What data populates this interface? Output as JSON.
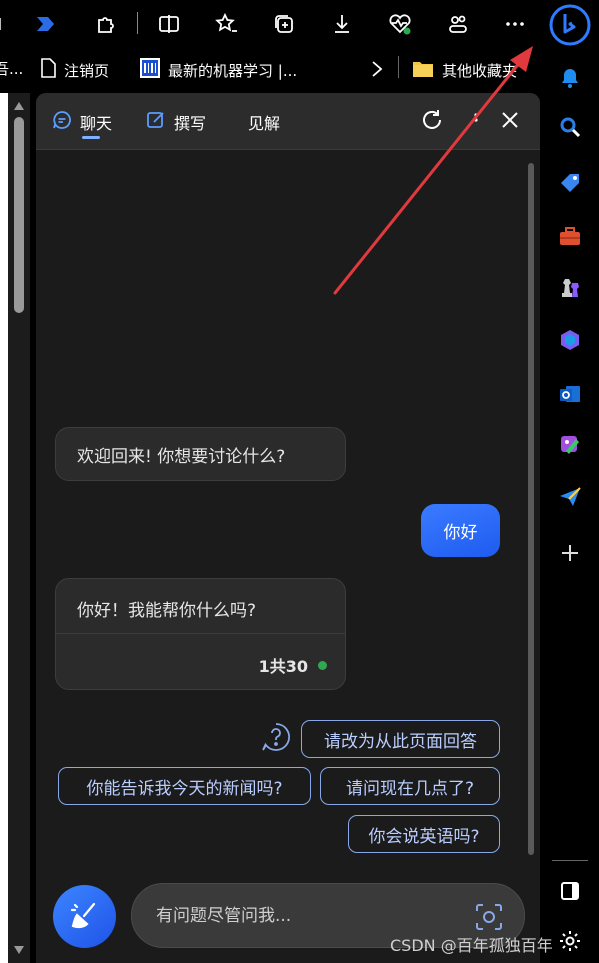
{
  "favorites": {
    "partial_left": "吾...",
    "items": [
      {
        "label": "注销页"
      },
      {
        "label": "最新的机器学习 |..."
      }
    ],
    "other_folder": "其他收藏夹"
  },
  "chat": {
    "tabs": [
      {
        "label": "聊天"
      },
      {
        "label": "撰写"
      },
      {
        "label": "见解"
      }
    ],
    "messages": {
      "welcome": "欢迎回来! 你想要讨论什么?",
      "user": "你好",
      "reply": "你好！我能帮你什么吗?",
      "counter": "1共30"
    },
    "suggestions": [
      "请改为从此页面回答",
      "你能告诉我今天的新闻吗?",
      "请问现在几点了?",
      "你会说英语吗?"
    ],
    "input_placeholder": "有问题尽管问我..."
  },
  "watermark": "CSDN @百年孤独百年",
  "colors": {
    "accent": "#2a6df5",
    "chip_border": "#8aa7e8",
    "status_dot": "#2fa84f",
    "arrow": "#e0393e"
  }
}
